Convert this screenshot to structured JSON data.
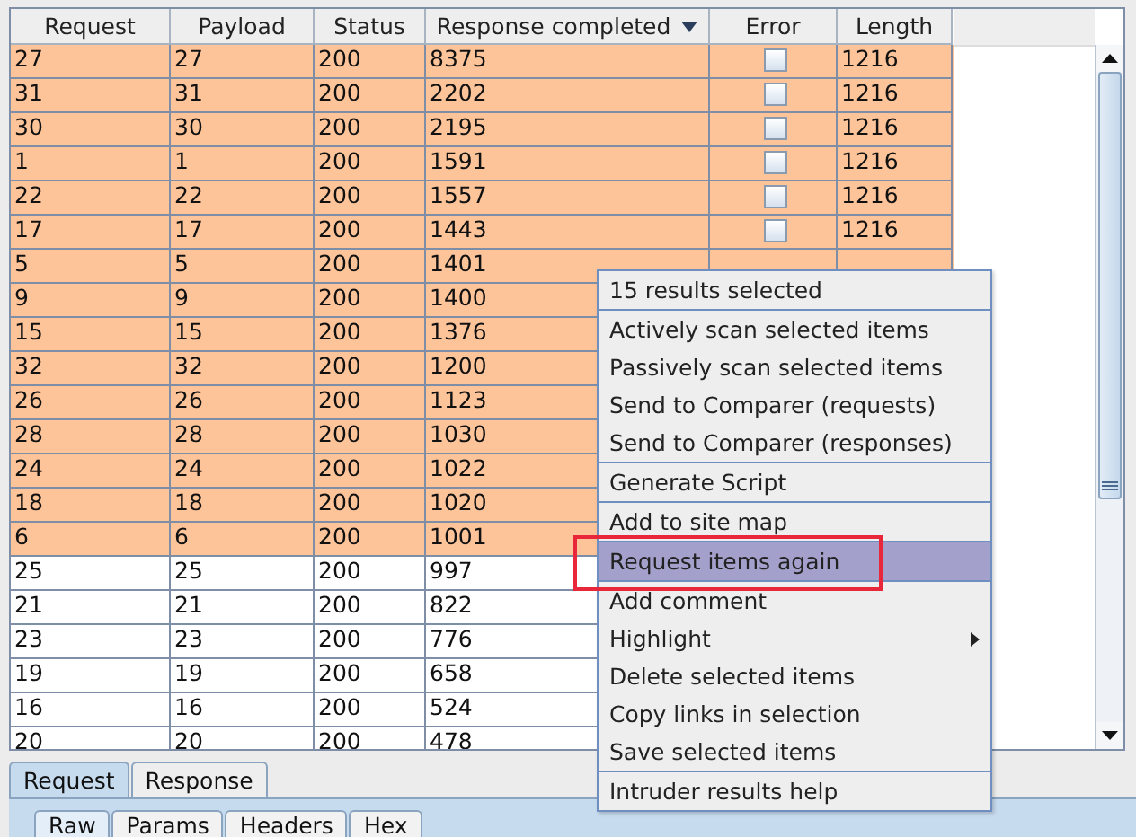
{
  "table": {
    "columns": [
      {
        "label": "Request",
        "sorted": false
      },
      {
        "label": "Payload",
        "sorted": false
      },
      {
        "label": "Status",
        "sorted": false
      },
      {
        "label": "Response completed",
        "sorted": true
      },
      {
        "label": "Error",
        "sorted": false
      },
      {
        "label": "Length",
        "sorted": false
      }
    ],
    "rows": [
      {
        "cells": [
          "27",
          "27",
          "200",
          "8375",
          "1216"
        ],
        "error": false,
        "selected": true
      },
      {
        "cells": [
          "31",
          "31",
          "200",
          "2202",
          "1216"
        ],
        "error": false,
        "selected": true
      },
      {
        "cells": [
          "30",
          "30",
          "200",
          "2195",
          "1216"
        ],
        "error": false,
        "selected": true
      },
      {
        "cells": [
          "1",
          "1",
          "200",
          "1591",
          "1216"
        ],
        "error": false,
        "selected": true
      },
      {
        "cells": [
          "22",
          "22",
          "200",
          "1557",
          "1216"
        ],
        "error": false,
        "selected": true
      },
      {
        "cells": [
          "17",
          "17",
          "200",
          "1443",
          "1216"
        ],
        "error": false,
        "selected": true
      },
      {
        "cells": [
          "5",
          "5",
          "200",
          "1401"
        ],
        "selected": true
      },
      {
        "cells": [
          "9",
          "9",
          "200",
          "1400"
        ],
        "selected": true
      },
      {
        "cells": [
          "15",
          "15",
          "200",
          "1376"
        ],
        "selected": true
      },
      {
        "cells": [
          "32",
          "32",
          "200",
          "1200"
        ],
        "selected": true
      },
      {
        "cells": [
          "26",
          "26",
          "200",
          "1123"
        ],
        "selected": true
      },
      {
        "cells": [
          "28",
          "28",
          "200",
          "1030"
        ],
        "selected": true
      },
      {
        "cells": [
          "24",
          "24",
          "200",
          "1022"
        ],
        "selected": true
      },
      {
        "cells": [
          "18",
          "18",
          "200",
          "1020"
        ],
        "selected": true
      },
      {
        "cells": [
          "6",
          "6",
          "200",
          "1001"
        ],
        "selected": true
      },
      {
        "cells": [
          "25",
          "25",
          "200",
          "997"
        ],
        "selected": false
      },
      {
        "cells": [
          "21",
          "21",
          "200",
          "822"
        ],
        "selected": false
      },
      {
        "cells": [
          "23",
          "23",
          "200",
          "776"
        ],
        "selected": false
      },
      {
        "cells": [
          "19",
          "19",
          "200",
          "658"
        ],
        "selected": false
      },
      {
        "cells": [
          "16",
          "16",
          "200",
          "524"
        ],
        "selected": false
      },
      {
        "cells": [
          "20",
          "20",
          "200",
          "478"
        ],
        "selected": false
      }
    ]
  },
  "context_menu": {
    "groups": [
      [
        {
          "label": "15 results selected",
          "kind": "header",
          "selected": false
        }
      ],
      [
        {
          "label": "Actively scan selected items",
          "kind": "item",
          "selected": false
        },
        {
          "label": "Passively scan selected items",
          "kind": "item",
          "selected": false
        },
        {
          "label": "Send to Comparer (requests)",
          "kind": "item",
          "selected": false
        },
        {
          "label": "Send to Comparer (responses)",
          "kind": "item",
          "selected": false
        }
      ],
      [
        {
          "label": "Generate Script",
          "kind": "item",
          "selected": false
        }
      ],
      [
        {
          "label": "Add to site map",
          "kind": "item",
          "selected": false
        }
      ],
      [
        {
          "label": "Request items again",
          "kind": "item",
          "selected": true,
          "outlined": true
        }
      ],
      [
        {
          "label": "Add comment",
          "kind": "item",
          "selected": false
        },
        {
          "label": "Highlight",
          "kind": "submenu",
          "selected": false
        },
        {
          "label": "Delete selected items",
          "kind": "item",
          "selected": false
        },
        {
          "label": "Copy links in selection",
          "kind": "item",
          "selected": false
        },
        {
          "label": "Save selected items",
          "kind": "item",
          "selected": false
        }
      ],
      [
        {
          "label": "Intruder results help",
          "kind": "item",
          "selected": false
        }
      ]
    ]
  },
  "message_tabs": [
    {
      "label": "Request",
      "selected": true
    },
    {
      "label": "Response",
      "selected": false
    }
  ],
  "view_tabs": [
    {
      "label": "Raw",
      "selected": true
    },
    {
      "label": "Params",
      "selected": false
    },
    {
      "label": "Headers",
      "selected": false
    },
    {
      "label": "Hex",
      "selected": false
    }
  ]
}
